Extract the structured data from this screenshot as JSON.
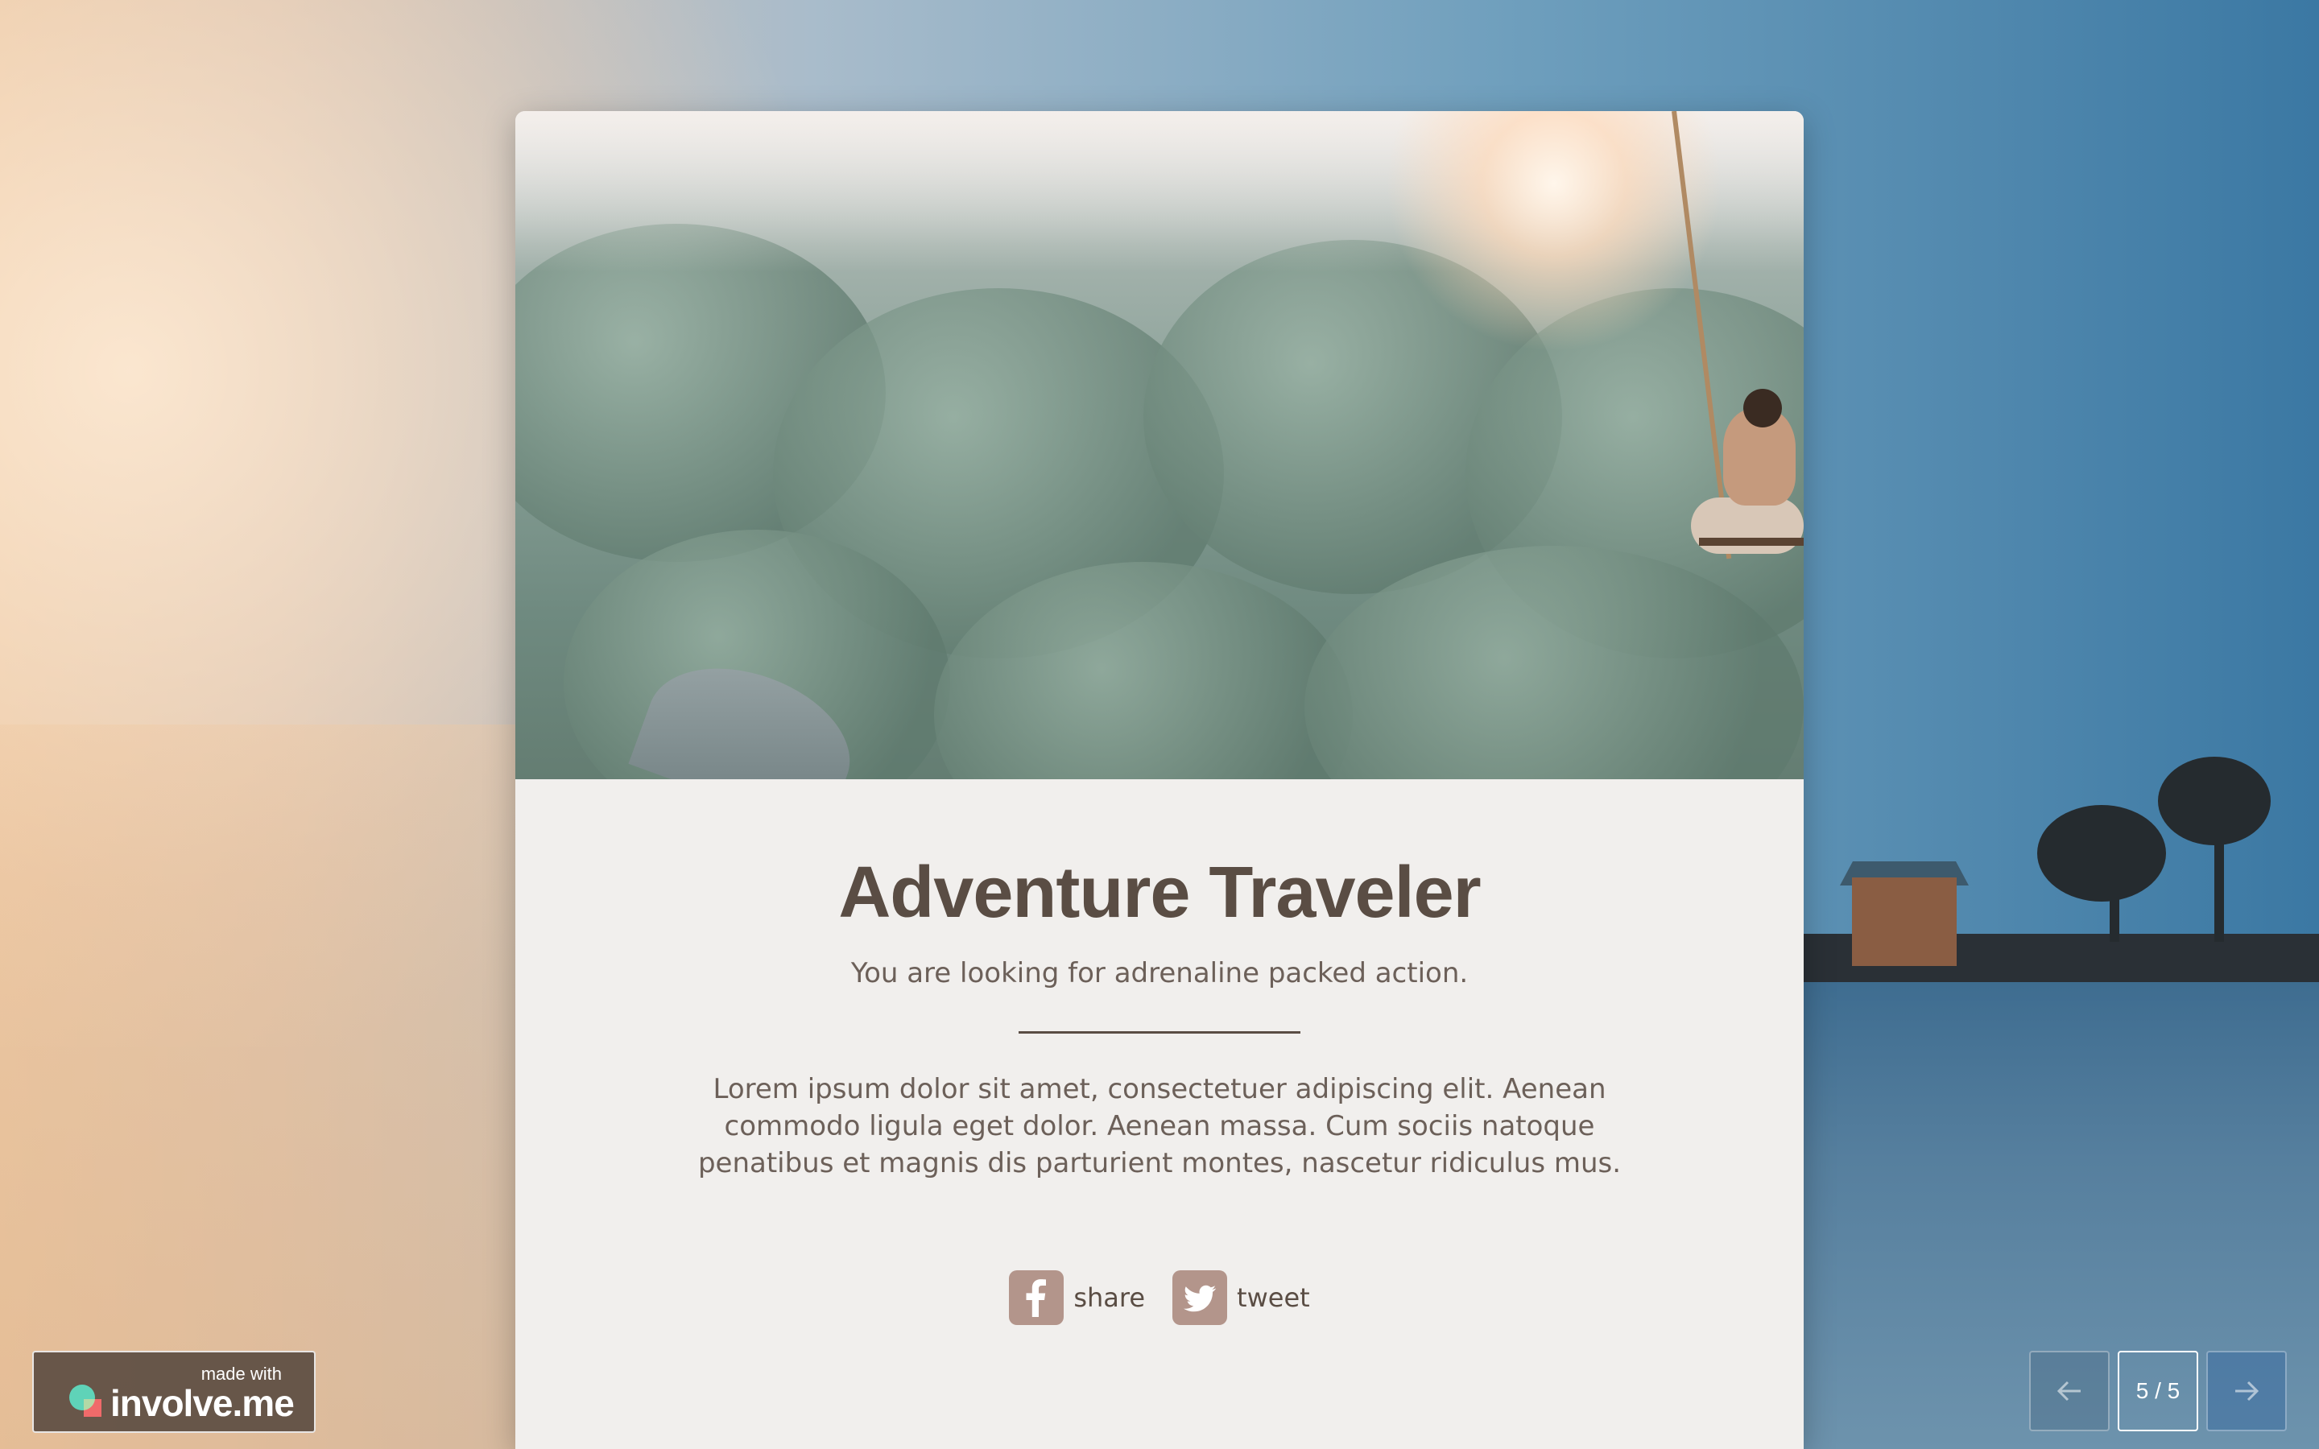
{
  "result": {
    "title": "Adventure Traveler",
    "subtitle": "You are looking for adrenaline packed action.",
    "body": "Lorem ipsum dolor sit amet, consectetuer adipiscing elit. Aenean commodo ligula eget dolor. Aenean massa. Cum sociis natoque penatibus et magnis dis parturient montes, nascetur ridiculus mus.",
    "hero_image": "man-on-jungle-swing"
  },
  "share": {
    "facebook_label": "share",
    "twitter_label": "tweet",
    "facebook_icon": "facebook-icon",
    "twitter_icon": "twitter-icon"
  },
  "branding": {
    "made_with": "made with",
    "name": "involve.me"
  },
  "pagination": {
    "current": "5 / 5",
    "prev_icon": "arrow-left-icon",
    "next_icon": "arrow-right-icon"
  },
  "colors": {
    "card_bg": "#f1efed",
    "title": "#5a4d44",
    "text": "#6c6059",
    "icon_bg": "#b3958b"
  }
}
